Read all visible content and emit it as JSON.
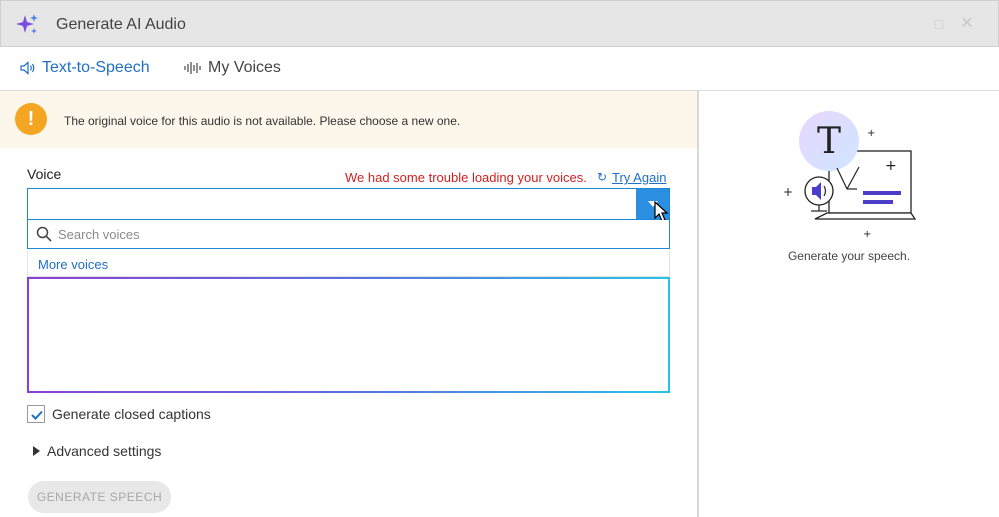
{
  "window": {
    "title": "Generate AI Audio",
    "maximize_glyph": "□",
    "close_glyph": "✕"
  },
  "tabs": [
    {
      "label": "Text-to-Speech",
      "icon": "speaker-icon",
      "active": true
    },
    {
      "label": "My Voices",
      "icon": "waveform-icon",
      "active": false
    }
  ],
  "warning": {
    "icon_glyph": "!",
    "text": "The original voice for this audio is not available. Please choose a new one."
  },
  "voice": {
    "label": "Voice",
    "error": "We had some trouble loading your voices.",
    "retry_glyph": "↻",
    "try_again": "Try Again",
    "selected": ""
  },
  "search": {
    "placeholder": "Search voices",
    "value": ""
  },
  "more_voices": "More voices",
  "captions": {
    "label": "Generate closed captions",
    "checked": true
  },
  "advanced": {
    "label": "Advanced settings"
  },
  "generate_button": "GENERATE SPEECH",
  "preview": {
    "illustration_letter": "T",
    "caption": "Generate your speech."
  },
  "colors": {
    "accent": "#1f6fc4",
    "error": "#d21f1f",
    "warning": "#f4a623",
    "gradient_start": "#8b3fd6",
    "gradient_end": "#29c3e8"
  }
}
